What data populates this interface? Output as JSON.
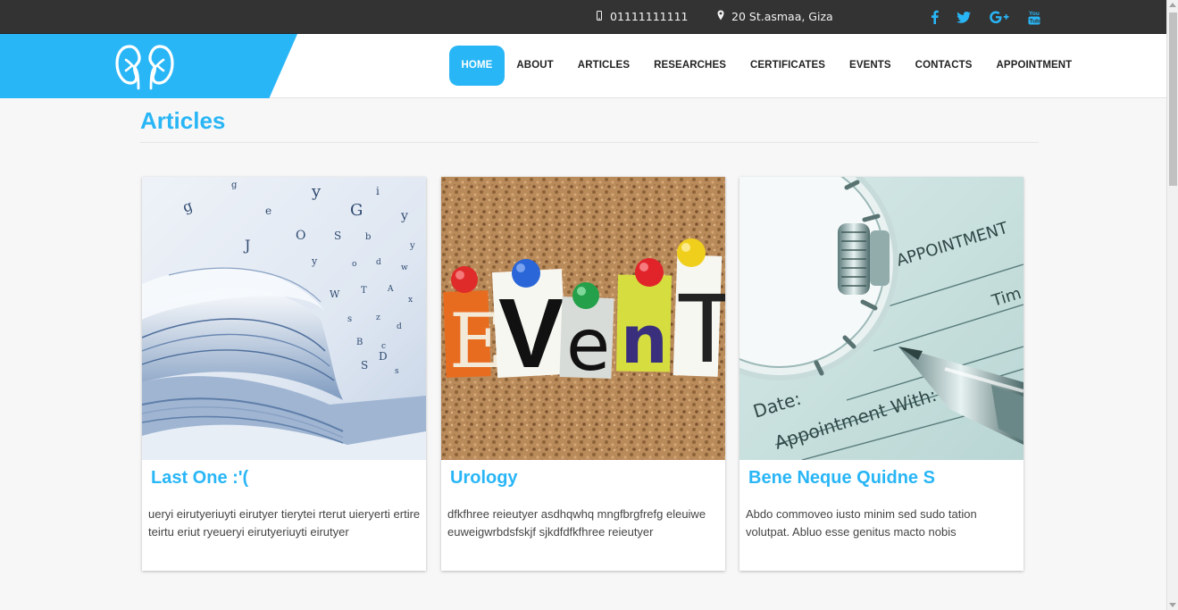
{
  "topbar": {
    "phone": "01111111111",
    "address": "20 St.asmaa, Giza",
    "social_icons": [
      "facebook-icon",
      "twitter-icon",
      "google-plus-icon",
      "youtube-icon"
    ]
  },
  "header": {
    "logo_icon": "kidneys-icon",
    "nav": [
      {
        "label": "HOME",
        "active": true
      },
      {
        "label": "ABOUT"
      },
      {
        "label": "ARTICLES"
      },
      {
        "label": "RESEARCHES"
      },
      {
        "label": "CERTIFICATES"
      },
      {
        "label": "EVENTS"
      },
      {
        "label": "CONTACTS"
      },
      {
        "label": "APPOINTMENT"
      }
    ]
  },
  "main": {
    "title": "Articles",
    "articles": [
      {
        "title": "Last One :'(",
        "text": "ueryi eirutyeriuyti eirutyer tierytei rterut uieryerti ertire teirtu eriut ryeueryi eirutyeriuyti eirutyer",
        "image": "book-with-letters-photo"
      },
      {
        "title": "Urology",
        "text": "dfkfhree reieutyer asdhqwhq mngfbrgfrefg eleuiwe euweigwrbdsfskjf sjkdfdfkfhree reieutyer",
        "image": "event-corkboard-photo"
      },
      {
        "title": "Bene Neque Quidne S",
        "text": "Abdo commoveo iusto minim sed sudo tation volutpat. Abluo esse genitus macto nobis",
        "image": "appointment-watch-pen-photo"
      }
    ]
  },
  "colors": {
    "accent": "#29b6f6",
    "topbar": "#333333",
    "background": "#f7f7f7"
  },
  "image_text": {
    "event": "EVenT",
    "appointment_form": [
      "APPOINTMENT",
      "Tim",
      "Date:",
      "Appointment With:"
    ]
  }
}
